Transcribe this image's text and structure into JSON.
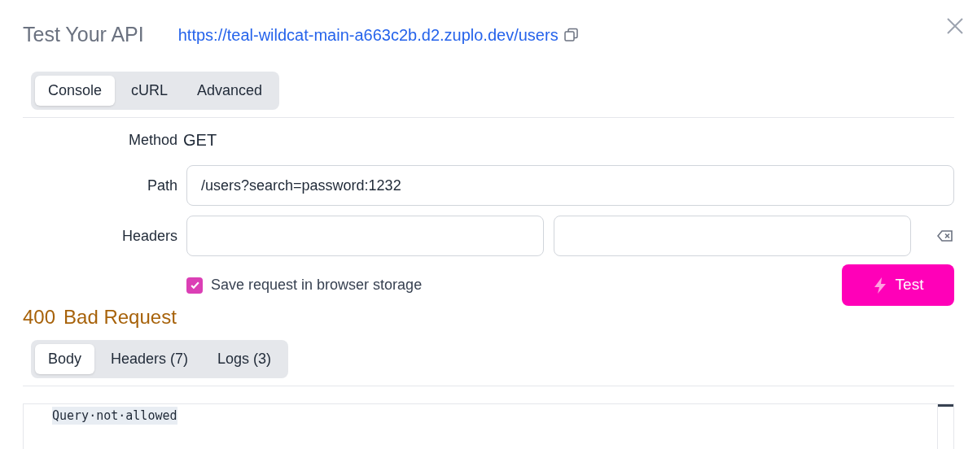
{
  "header": {
    "title": "Test Your API",
    "url": "https://teal-wildcat-main-a663c2b.d2.zuplo.dev/users"
  },
  "request_tabs": [
    {
      "label": "Console",
      "selected": true
    },
    {
      "label": "cURL",
      "selected": false
    },
    {
      "label": "Advanced",
      "selected": false
    }
  ],
  "method": {
    "label": "Method",
    "value": "GET"
  },
  "path": {
    "label": "Path",
    "value": "/users?search=password:1232"
  },
  "headers": {
    "label": "Headers"
  },
  "save_request": {
    "label": "Save request in browser storage",
    "checked": true
  },
  "test_button": "Test",
  "response": {
    "code": "400",
    "status": "Bad Request"
  },
  "response_tabs": [
    {
      "label": "Body",
      "selected": true
    },
    {
      "label": "Headers (7)",
      "selected": false
    },
    {
      "label": "Logs (3)",
      "selected": false
    }
  ],
  "body": "Query·not·allowed"
}
